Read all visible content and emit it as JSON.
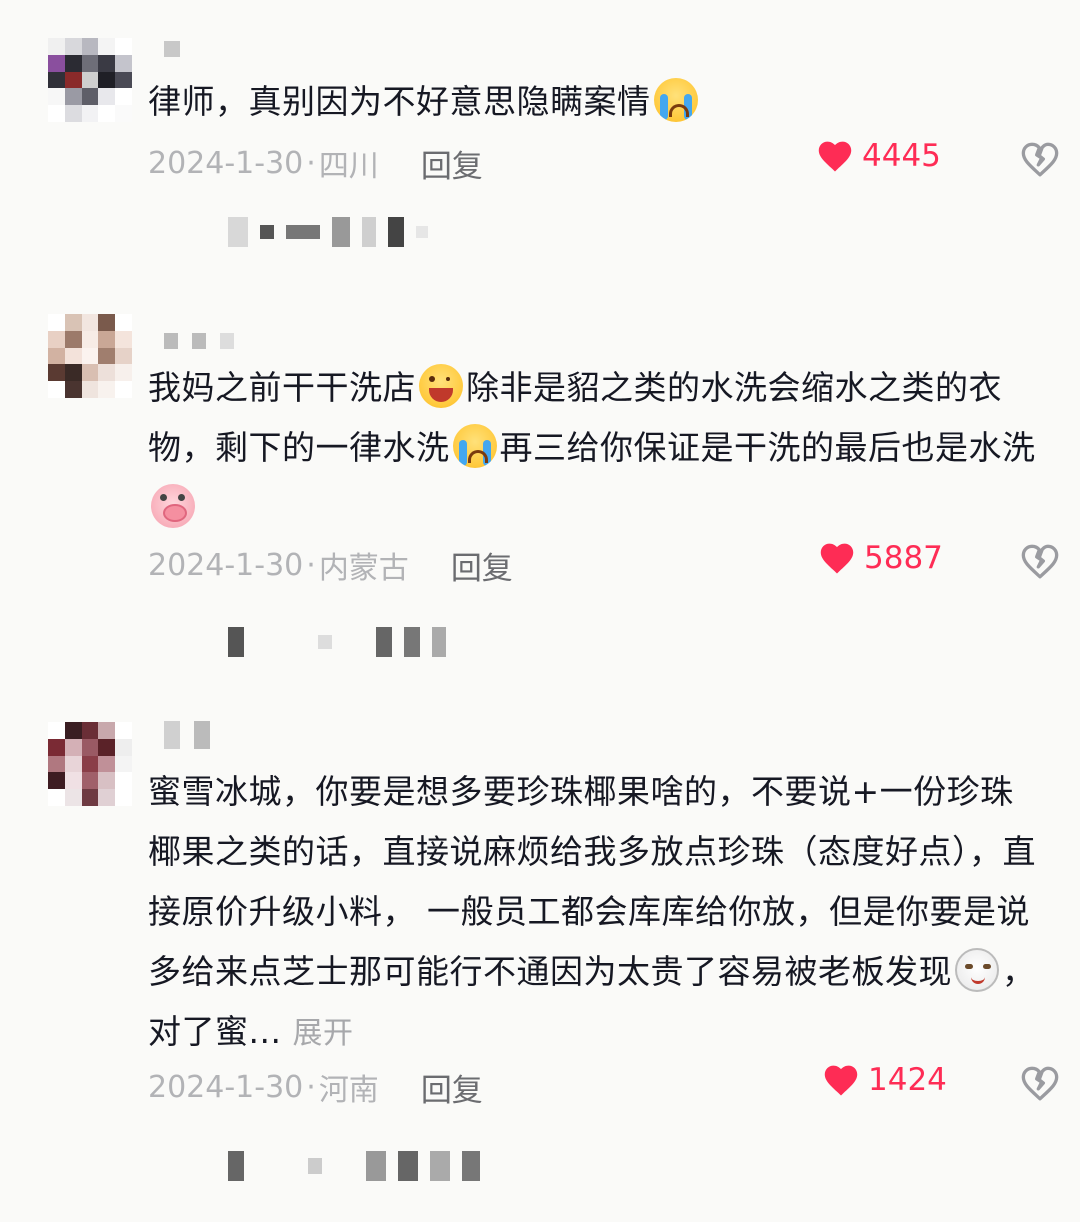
{
  "comments": [
    {
      "text_parts": [
        "律师，真别因为不好意思隐瞒案情"
      ],
      "emojis": [
        "crying-face"
      ],
      "date": "2024-1-30",
      "separator": "·",
      "location": "四川",
      "reply_label": "回复",
      "likes": "4445",
      "username": "",
      "avatar_colors": [
        "#f0f0f0",
        "#d8d8dc",
        "#b8b8c0",
        "#f4f4f4",
        "#ffffff",
        "#8a4f9e",
        "#2b2b33",
        "#6e6e78",
        "#3a3a44",
        "#c4c4cc",
        "#303038",
        "#8a2a2a",
        "#cfcfcf",
        "#1f1f26",
        "#4a4a55",
        "#f7f7f7",
        "#9a9aa4",
        "#5e5e68",
        "#e8e8ec",
        "#ffffff",
        "#ffffff",
        "#dcdce0",
        "#f2f2f4",
        "#ffffff",
        "#fafafa"
      ]
    },
    {
      "text_parts": [
        "我妈之前干干洗店",
        "除非是貂之类的水洗会缩水之类的衣物，剩下的一律水洗",
        "再三给你保证是干洗的最后也是水洗"
      ],
      "emojis": [
        "winking-tongue-face",
        "crying-face",
        "pig-face"
      ],
      "date": "2024-1-30",
      "separator": "·",
      "location": "内蒙古",
      "reply_label": "回复",
      "likes": "5887",
      "username": "",
      "avatar_colors": [
        "#ffffff",
        "#d9c3b5",
        "#f2e6e0",
        "#7a5a4c",
        "#ffffff",
        "#e8d0c4",
        "#9c7a6a",
        "#f7ece6",
        "#c9a796",
        "#f4e4dc",
        "#d2b2a2",
        "#f3e2da",
        "#fbf3ef",
        "#a07e6e",
        "#e6d2c8",
        "#5a3a32",
        "#3a2a26",
        "#d9bfb2",
        "#ede0da",
        "#f7f0ec",
        "#ffffff",
        "#4a3430",
        "#efe4de",
        "#f8f2ee",
        "#ffffff"
      ]
    },
    {
      "text_parts": [
        "蜜雪冰城，你要是想多要珍珠椰果啥的，不要说+一份珍珠椰果之类的话，直接说麻烦给我多放点珍珠（态度好点），直接原价升级小料， 一般员工都会库库给你放，但是你要是说多给来点芝士那可能行不通因为太贵了容易被老板发现",
        "，对了蜜..."
      ],
      "emojis": [
        "cat-face"
      ],
      "expand_label": "展开",
      "date": "2024-1-30",
      "separator": "·",
      "location": "河南",
      "reply_label": "回复",
      "likes": "1424",
      "username": "",
      "avatar_colors": [
        "#ffffff",
        "#3a1e22",
        "#6a2e36",
        "#c8a8ac",
        "#ffffff",
        "#7a2a34",
        "#d4b0b6",
        "#9a5a64",
        "#5a2228",
        "#eeeeee",
        "#b07880",
        "#e8d4d8",
        "#8a3e48",
        "#c09098",
        "#f4f4f4",
        "#3e1c22",
        "#f0e0e4",
        "#a0606a",
        "#d8c0c4",
        "#ffffff",
        "#ffffff",
        "#ece4e6",
        "#6e3a42",
        "#e0d0d4",
        "#ffffff"
      ]
    }
  ],
  "colors": {
    "background": "#fafaf8",
    "text": "#161823",
    "meta": "#b2b3b6",
    "reply": "#6b6c70",
    "like": "#fe2c55",
    "dislike_icon": "#9a9ba0"
  },
  "icons": {
    "like": "heart-icon",
    "dislike": "broken-heart-icon"
  }
}
